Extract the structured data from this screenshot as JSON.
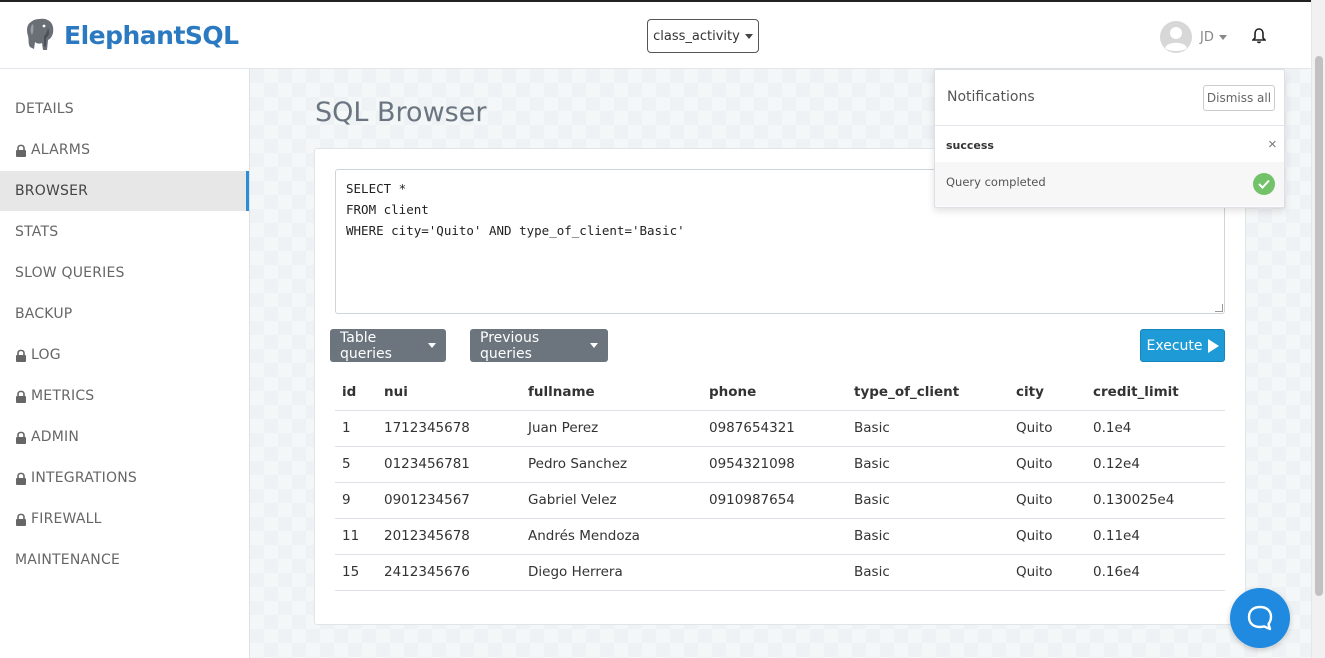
{
  "app": {
    "title": "ElephantSQL"
  },
  "instance": {
    "selected": "class_activity"
  },
  "user": {
    "initials": "JD"
  },
  "sidebar": {
    "items": [
      {
        "label": "DETAILS",
        "locked": false
      },
      {
        "label": "ALARMS",
        "locked": true
      },
      {
        "label": "BROWSER",
        "locked": false,
        "active": true
      },
      {
        "label": "STATS",
        "locked": false
      },
      {
        "label": "SLOW QUERIES",
        "locked": false
      },
      {
        "label": "BACKUP",
        "locked": false
      },
      {
        "label": "LOG",
        "locked": true
      },
      {
        "label": "METRICS",
        "locked": true
      },
      {
        "label": "ADMIN",
        "locked": true
      },
      {
        "label": "INTEGRATIONS",
        "locked": true
      },
      {
        "label": "FIREWALL",
        "locked": true
      },
      {
        "label": "MAINTENANCE",
        "locked": false
      }
    ]
  },
  "main": {
    "title": "SQL Browser",
    "query": "SELECT *\nFROM client\nWHERE city='Quito' AND type_of_client='Basic'",
    "table_queries_label": "Table queries",
    "previous_queries_label": "Previous queries",
    "execute_label": "Execute"
  },
  "results": {
    "columns": [
      "id",
      "nui",
      "fullname",
      "phone",
      "type_of_client",
      "city",
      "credit_limit"
    ],
    "rows": [
      [
        "1",
        "1712345678",
        "Juan Perez",
        "0987654321",
        "Basic",
        "Quito",
        "0.1e4"
      ],
      [
        "5",
        "0123456781",
        "Pedro Sanchez",
        "0954321098",
        "Basic",
        "Quito",
        "0.12e4"
      ],
      [
        "9",
        "0901234567",
        "Gabriel Velez",
        "0910987654",
        "Basic",
        "Quito",
        "0.130025e4"
      ],
      [
        "11",
        "2012345678",
        "Andrés Mendoza",
        "",
        "Basic",
        "Quito",
        "0.11e4"
      ],
      [
        "15",
        "2412345676",
        "Diego Herrera",
        "",
        "Basic",
        "Quito",
        "0.16e4"
      ]
    ]
  },
  "notifications": {
    "title": "Notifications",
    "dismiss_label": "Dismiss all",
    "items": [
      {
        "type": "success",
        "message": "Query completed"
      }
    ]
  },
  "colors": {
    "brand": "#2a79c1",
    "execute": "#1e9bd7",
    "secondary_button": "#6c757d",
    "active_indicator": "#2a8fd6",
    "success": "#72c26a"
  },
  "icons": [
    "elephant-logo-icon",
    "avatar-icon",
    "bell-icon",
    "lock-icon",
    "play-icon",
    "close-icon",
    "check-icon",
    "chat-icon"
  ]
}
